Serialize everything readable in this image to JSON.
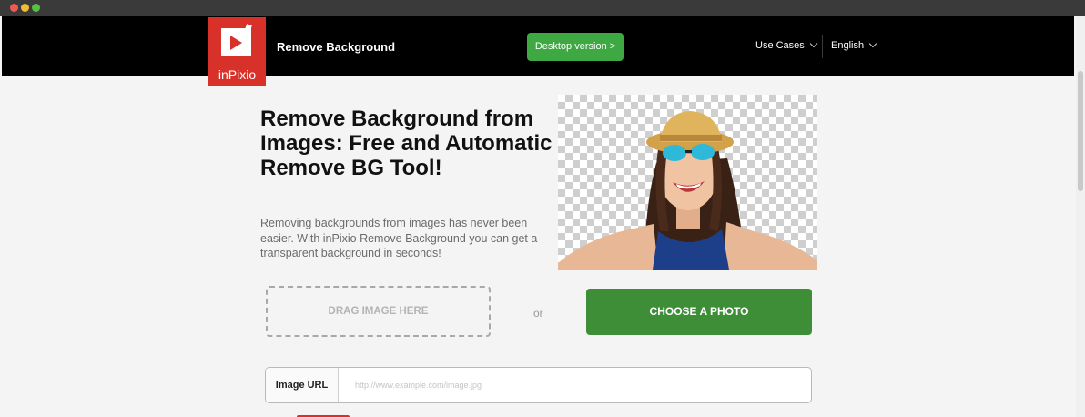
{
  "window": {
    "controls": [
      "close",
      "minimize",
      "maximize"
    ],
    "colors": {
      "close": "#ee5b54",
      "minimize": "#f2bd33",
      "maximize": "#54c23f"
    }
  },
  "header": {
    "logo_text": "inPixio",
    "logo_icon": "inpixio-logo-icon",
    "title": "Remove Background",
    "desktop_button": "Desktop version >",
    "nav": [
      {
        "label": "Use Cases",
        "icon": "chevron-down-icon"
      },
      {
        "label": "English",
        "icon": "chevron-down-icon"
      }
    ],
    "colors": {
      "bar": "#000000",
      "logo": "#d8312a",
      "desktop_button": "#3ea842"
    }
  },
  "hero": {
    "title": "Remove Background from Images: Free and Automatic Remove BG Tool!",
    "description": "Removing backgrounds from images has never been easier. With inPixio Remove Background you can get a transparent background in seconds!",
    "image": "woman-with-sunglasses-on-transparent-background"
  },
  "upload": {
    "drop_label": "DRAG IMAGE HERE",
    "or_label": "or",
    "choose_button": "CHOOSE A PHOTO",
    "choose_color": "#3d8e37"
  },
  "url": {
    "label": "Image URL",
    "placeholder": "http://www.example.com/image.jpg",
    "value": ""
  }
}
